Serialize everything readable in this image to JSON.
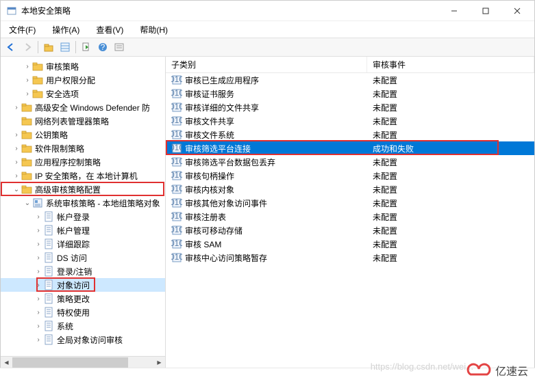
{
  "window": {
    "title": "本地安全策略",
    "controls": {
      "min": "–",
      "max": "□",
      "close": "×"
    }
  },
  "menu": {
    "file": "文件(F)",
    "action": "操作(A)",
    "view": "查看(V)",
    "help": "帮助(H)"
  },
  "toolbar": {
    "back": "back-icon",
    "forward": "forward-icon",
    "up": "up-icon",
    "grid": "grid-icon",
    "export": "export-icon",
    "refresh": "refresh-icon",
    "help": "help-icon",
    "props": "props-icon"
  },
  "tree": {
    "items": [
      {
        "lvl": 2,
        "exp": ">",
        "label": "审核策略"
      },
      {
        "lvl": 2,
        "exp": ">",
        "label": "用户权限分配"
      },
      {
        "lvl": 2,
        "exp": ">",
        "label": "安全选项"
      },
      {
        "lvl": 1,
        "exp": ">",
        "label": "高级安全 Windows Defender 防"
      },
      {
        "lvl": 1,
        "exp": " ",
        "label": "网络列表管理器策略"
      },
      {
        "lvl": 1,
        "exp": ">",
        "label": "公钥策略"
      },
      {
        "lvl": 1,
        "exp": ">",
        "label": "软件限制策略"
      },
      {
        "lvl": 1,
        "exp": ">",
        "label": "应用程序控制策略"
      },
      {
        "lvl": 1,
        "exp": ">",
        "label": "IP 安全策略，在 本地计算机"
      },
      {
        "lvl": 1,
        "exp": "v",
        "label": "高级审核策略配置",
        "boxed": true
      },
      {
        "lvl": 2,
        "exp": "v",
        "label": "系统审核策略 - 本地组策略对象",
        "strong": true
      },
      {
        "lvl": 3,
        "exp": ">",
        "label": "帐户登录",
        "doc": true
      },
      {
        "lvl": 3,
        "exp": ">",
        "label": "帐户管理",
        "doc": true
      },
      {
        "lvl": 3,
        "exp": ">",
        "label": "详细跟踪",
        "doc": true
      },
      {
        "lvl": 3,
        "exp": ">",
        "label": "DS 访问",
        "doc": true
      },
      {
        "lvl": 3,
        "exp": ">",
        "label": "登录/注销",
        "doc": true
      },
      {
        "lvl": 3,
        "exp": ">",
        "label": "对象访问",
        "doc": true,
        "boxed": true,
        "selected": true
      },
      {
        "lvl": 3,
        "exp": ">",
        "label": "策略更改",
        "doc": true
      },
      {
        "lvl": 3,
        "exp": ">",
        "label": "特权使用",
        "doc": true
      },
      {
        "lvl": 3,
        "exp": ">",
        "label": "系统",
        "doc": true
      },
      {
        "lvl": 3,
        "exp": ">",
        "label": "全局对象访问审核",
        "doc": true
      }
    ]
  },
  "list": {
    "columns": {
      "c1": "子类别",
      "c2": "审核事件"
    },
    "rows": [
      {
        "name": "审核已生成应用程序",
        "val": "未配置"
      },
      {
        "name": "审核证书服务",
        "val": "未配置"
      },
      {
        "name": "审核详细的文件共享",
        "val": "未配置"
      },
      {
        "name": "审核文件共享",
        "val": "未配置"
      },
      {
        "name": "审核文件系统",
        "val": "未配置"
      },
      {
        "name": "审核筛选平台连接",
        "val": "成功和失败",
        "selected": true,
        "boxed": true
      },
      {
        "name": "审核筛选平台数据包丢弃",
        "val": "未配置"
      },
      {
        "name": "审核句柄操作",
        "val": "未配置"
      },
      {
        "name": "审核内核对象",
        "val": "未配置"
      },
      {
        "name": "审核其他对象访问事件",
        "val": "未配置"
      },
      {
        "name": "审核注册表",
        "val": "未配置"
      },
      {
        "name": "审核可移动存储",
        "val": "未配置"
      },
      {
        "name": "审核 SAM",
        "val": "未配置"
      },
      {
        "name": "审核中心访问策略暂存",
        "val": "未配置"
      }
    ]
  },
  "watermark": {
    "url": "https://blog.csdn.net/wei...",
    "brand": "亿速云"
  }
}
